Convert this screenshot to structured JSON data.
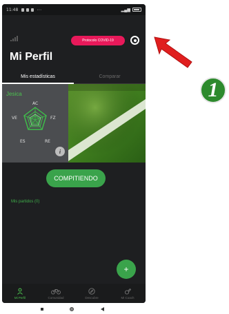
{
  "status_bar": {
    "time": "11:48",
    "dots": "···"
  },
  "header": {
    "protocol_button": "Protocolo COVID-19",
    "title": "Mi Perfil"
  },
  "tabs": [
    {
      "label": "Mis estadísticas",
      "active": true
    },
    {
      "label": "Comparar",
      "active": false
    }
  ],
  "stats_card": {
    "player_name": "Jesica",
    "radar_labels": {
      "top": "AC",
      "left": "VE",
      "right": "FZ",
      "bottom_left": "ES",
      "bottom_right": "RE"
    },
    "info_icon_label": "i"
  },
  "main": {
    "compete_button": "COMPITIENDO",
    "matches_label": "Mis partidos (0)",
    "fab_label": "+"
  },
  "bottom_nav": [
    {
      "label": "Mi Perfil",
      "icon": "person-icon",
      "active": true
    },
    {
      "label": "Comunidad",
      "icon": "bicycle-icon",
      "active": false
    },
    {
      "label": "Descubre",
      "icon": "compass-icon",
      "active": false
    },
    {
      "label": "Mi Coach",
      "icon": "whistle-icon",
      "active": false
    }
  ],
  "annotation": {
    "step_number": "1"
  },
  "colors": {
    "accent_green": "#3aa34b",
    "protocol_pink": "#e8195a",
    "background": "#1e1f21",
    "arrow_red": "#e01e1e"
  }
}
